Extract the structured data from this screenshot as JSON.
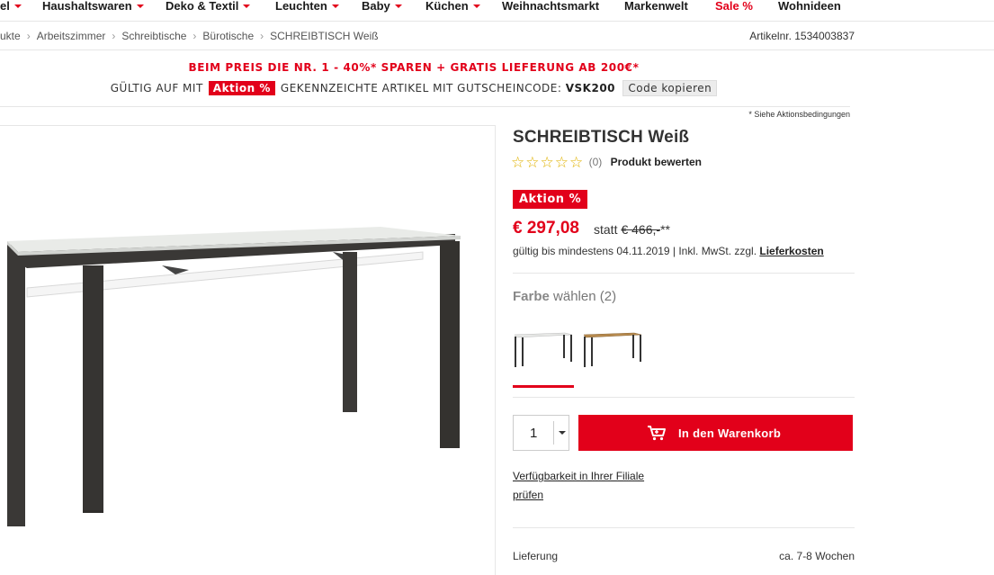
{
  "nav": {
    "items": [
      {
        "label": "el",
        "caret": true
      },
      {
        "label": "Haushaltswaren",
        "caret": true
      },
      {
        "label": "Deko & Textil",
        "caret": true
      },
      {
        "label": "Leuchten",
        "caret": true
      },
      {
        "label": "Baby",
        "caret": true
      },
      {
        "label": "Küchen",
        "caret": true
      },
      {
        "label": "Weihnachtsmarkt",
        "caret": false
      },
      {
        "label": "Markenwelt",
        "caret": false
      },
      {
        "label": "Sale %",
        "caret": false
      },
      {
        "label": "Wohnideen",
        "caret": false
      }
    ]
  },
  "breadcrumb": {
    "items": [
      "ukte",
      "Arbeitszimmer",
      "Schreibtische",
      "Bürotische"
    ],
    "current": "SCHREIBTISCH Weiß"
  },
  "article_number": "Artikelnr. 1534003837",
  "promo": {
    "headline": "BEIM PREIS DIE NR. 1 - 40%* SPAREN + GRATIS LIEFERUNG AB 200€*",
    "line_prefix": "GÜLTIG AUF MIT",
    "badge": "Aktion %",
    "line_middle": "GEKENNZEICHTE ARTIKEL MIT GUTSCHEINCODE:",
    "code": "VSK200",
    "copy_label": "Code kopieren",
    "conditions": "* Siehe Aktionsbedingungen"
  },
  "product": {
    "title": "SCHREIBTISCH Weiß",
    "rating_count": "(0)",
    "rate_label": "Produkt bewerten",
    "badge": "Aktion %",
    "price": "€ 297,08",
    "statt_label": "statt",
    "old_price": "€ 466,-",
    "old_suffix": "**",
    "valid_text": "gültig bis mindestens 04.11.2019 | Inkl. MwSt. zzgl.",
    "shipping_link": "Lieferkosten",
    "farbe_label": "Farbe",
    "farbe_suffix": "wählen (2)",
    "quantity": "1",
    "cart_label": "In den Warenkorb",
    "availability_line1": "Verfügbarkeit in Ihrer Filiale",
    "availability_line2": "prüfen",
    "delivery_label": "Lieferung",
    "delivery_value": "ca. 7-8 Wochen"
  },
  "colors": {
    "accent": "#e2001a",
    "star": "#e0b200"
  }
}
